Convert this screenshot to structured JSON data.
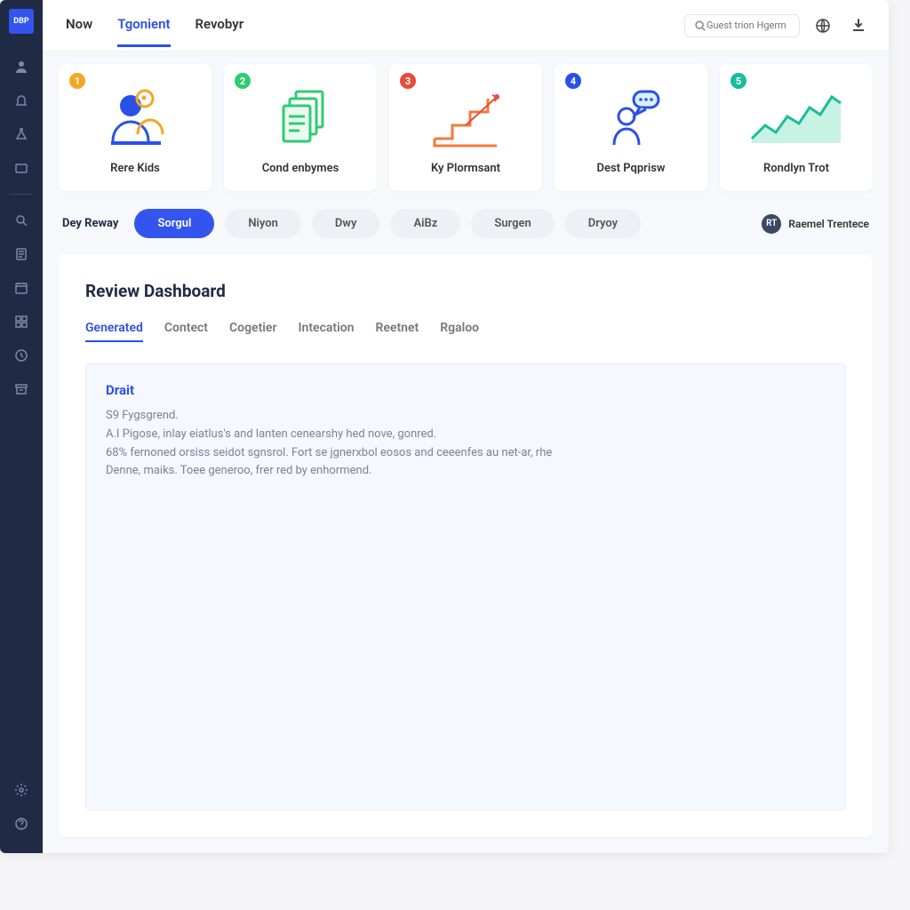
{
  "logo": "DBP",
  "topTabs": [
    "Now",
    "Tgonient",
    "Revobyr"
  ],
  "topTabActive": 1,
  "search": {
    "placeholder": "Guest trion Hgermany"
  },
  "cards": [
    {
      "num": "1",
      "title": "Rere Kids"
    },
    {
      "num": "2",
      "title": "Cond enbymes"
    },
    {
      "num": "3",
      "title": "Ky Plormsant"
    },
    {
      "num": "4",
      "title": "Dest Pqprisw"
    },
    {
      "num": "5",
      "title": "Rondlyn Trot"
    }
  ],
  "filters": {
    "label": "Dey Reway",
    "pills": [
      "Sorgul",
      "Niyon",
      "Dwy",
      "AiBz",
      "Surgen",
      "Dryoy"
    ],
    "active": 0
  },
  "author": {
    "initials": "RT",
    "name": "Raemel Trentece"
  },
  "panel": {
    "title": "Review Dashboard",
    "subtabs": [
      "Generated",
      "Contect",
      "Cogetier",
      "Intecation",
      "Reetnet",
      "Rgaloo"
    ],
    "subtabActive": 0,
    "draft": {
      "heading": "Drait",
      "line1": "S9 Fygsgrend.",
      "line2": "A.I Pigose, inlay eiatlus's and lanten cenearshy hed nove, gonred.",
      "line3": "68% fernoned orsiss seidot sgnsrol. Fort se jgnerxbol eosos and ceeenfes au net-ar, rhe Denne, maiks. Toee generoo, frer red by enhormend."
    }
  }
}
